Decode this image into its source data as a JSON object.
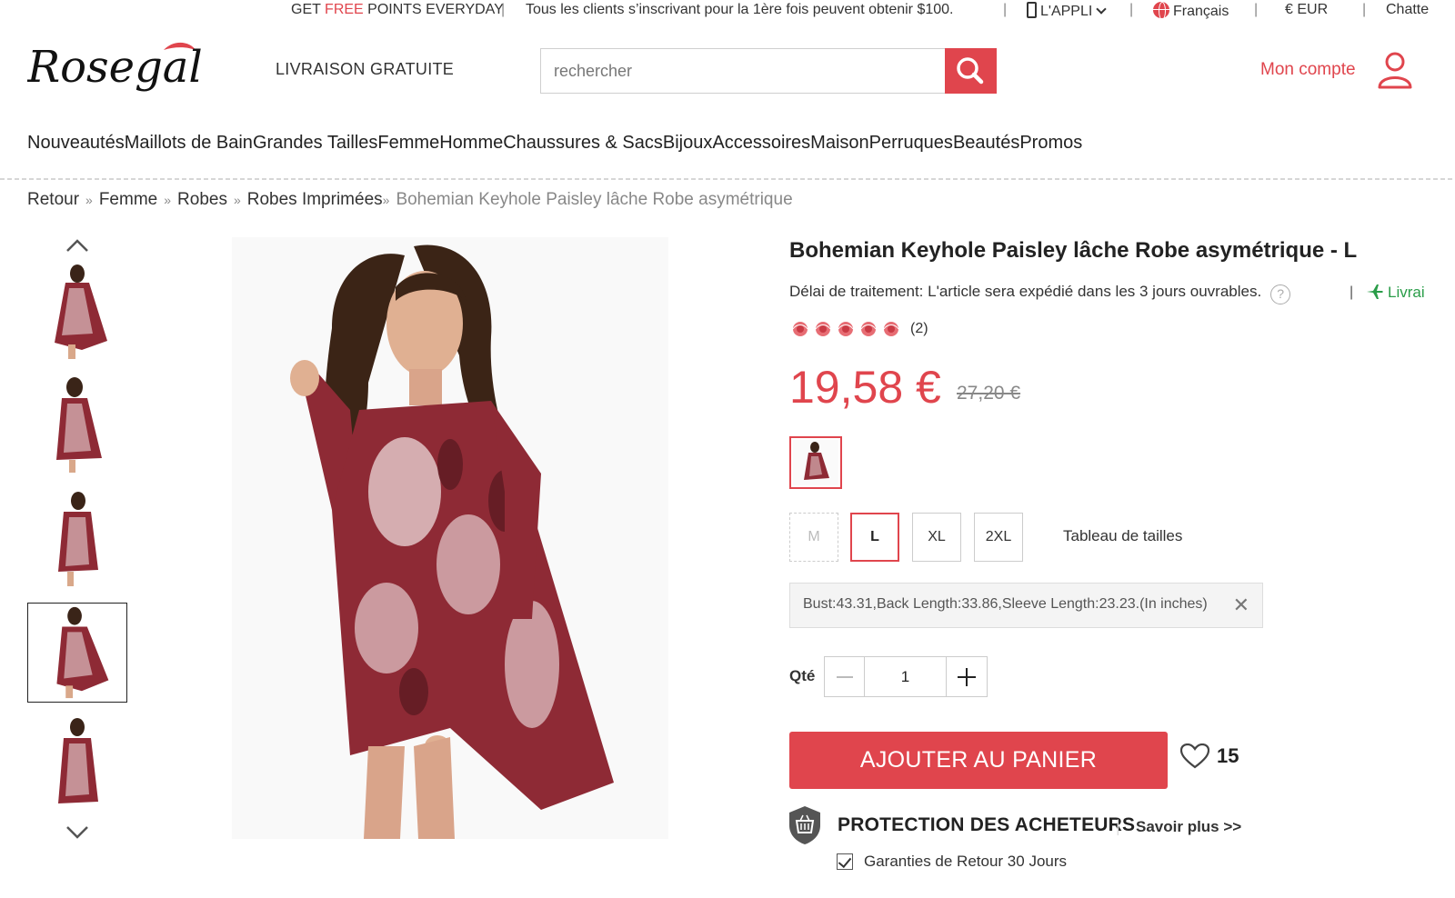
{
  "topbar": {
    "promo_prefix": "GET ",
    "promo_free": "FREE",
    "promo_suffix": " POINTS EVERYDAY",
    "new_client": "Tous les clients s’inscrivant pour la 1ère fois peuvent obtenir $100.",
    "app": "L'APPLI",
    "language": "Français",
    "currency": "€ EUR",
    "chat": "Chatte",
    "separator": "|"
  },
  "header": {
    "logo_text": "Rosegal",
    "shipping": "LIVRAISON GRATUITE",
    "search_placeholder": "rechercher",
    "account_label": "Mon compte"
  },
  "nav": {
    "items": [
      "Nouveautés",
      "Maillots de Bain",
      "Grandes Tailles",
      "Femme",
      "Homme",
      "Chaussures & Sacs",
      "Bijoux",
      "Accessoires",
      "Maison",
      "Perruques",
      "Beautés",
      "Promos"
    ]
  },
  "breadcrumb": {
    "items": [
      "Retour",
      "Femme",
      "Robes",
      "Robes Imprimées"
    ],
    "separator": "»",
    "current": "Bohemian Keyhole Paisley lâche Robe asymétrique"
  },
  "product": {
    "title": "Bohemian Keyhole Paisley lâche Robe asymétrique - L",
    "processing": "Délai de traitement: L'article sera expédié dans les 3 jours ouvrables.",
    "help_symbol": "?",
    "delivery_sep": "|",
    "delivery": "Livrai",
    "rating": 5,
    "reviews": "(2)",
    "price": "19,58 €",
    "old_price": "27,20 €",
    "sizes": [
      {
        "label": "M",
        "state": "disabled"
      },
      {
        "label": "L",
        "state": "selected"
      },
      {
        "label": "XL",
        "state": "normal"
      },
      {
        "label": "2XL",
        "state": "normal"
      }
    ],
    "size_chart": "Tableau de tailles",
    "measurements": "Bust:43.31,Back Length:33.86,Sleeve Length:23.23.(In inches)",
    "close_symbol": "✕",
    "qty_label": "Qté",
    "qty_value": "1",
    "add_to_cart": "AJOUTER AU PANIER",
    "wishlist_count": "15",
    "protection_title": "PROTECTION DES ACHETEURS",
    "protection_sep": "|",
    "learn_more": "Savoir plus >>",
    "guarantee": "Garanties de Retour 30 Jours"
  },
  "colors": {
    "accent": "#e0454d",
    "dress_red": "#8e2a35",
    "delivery_green": "#2a9d49"
  }
}
